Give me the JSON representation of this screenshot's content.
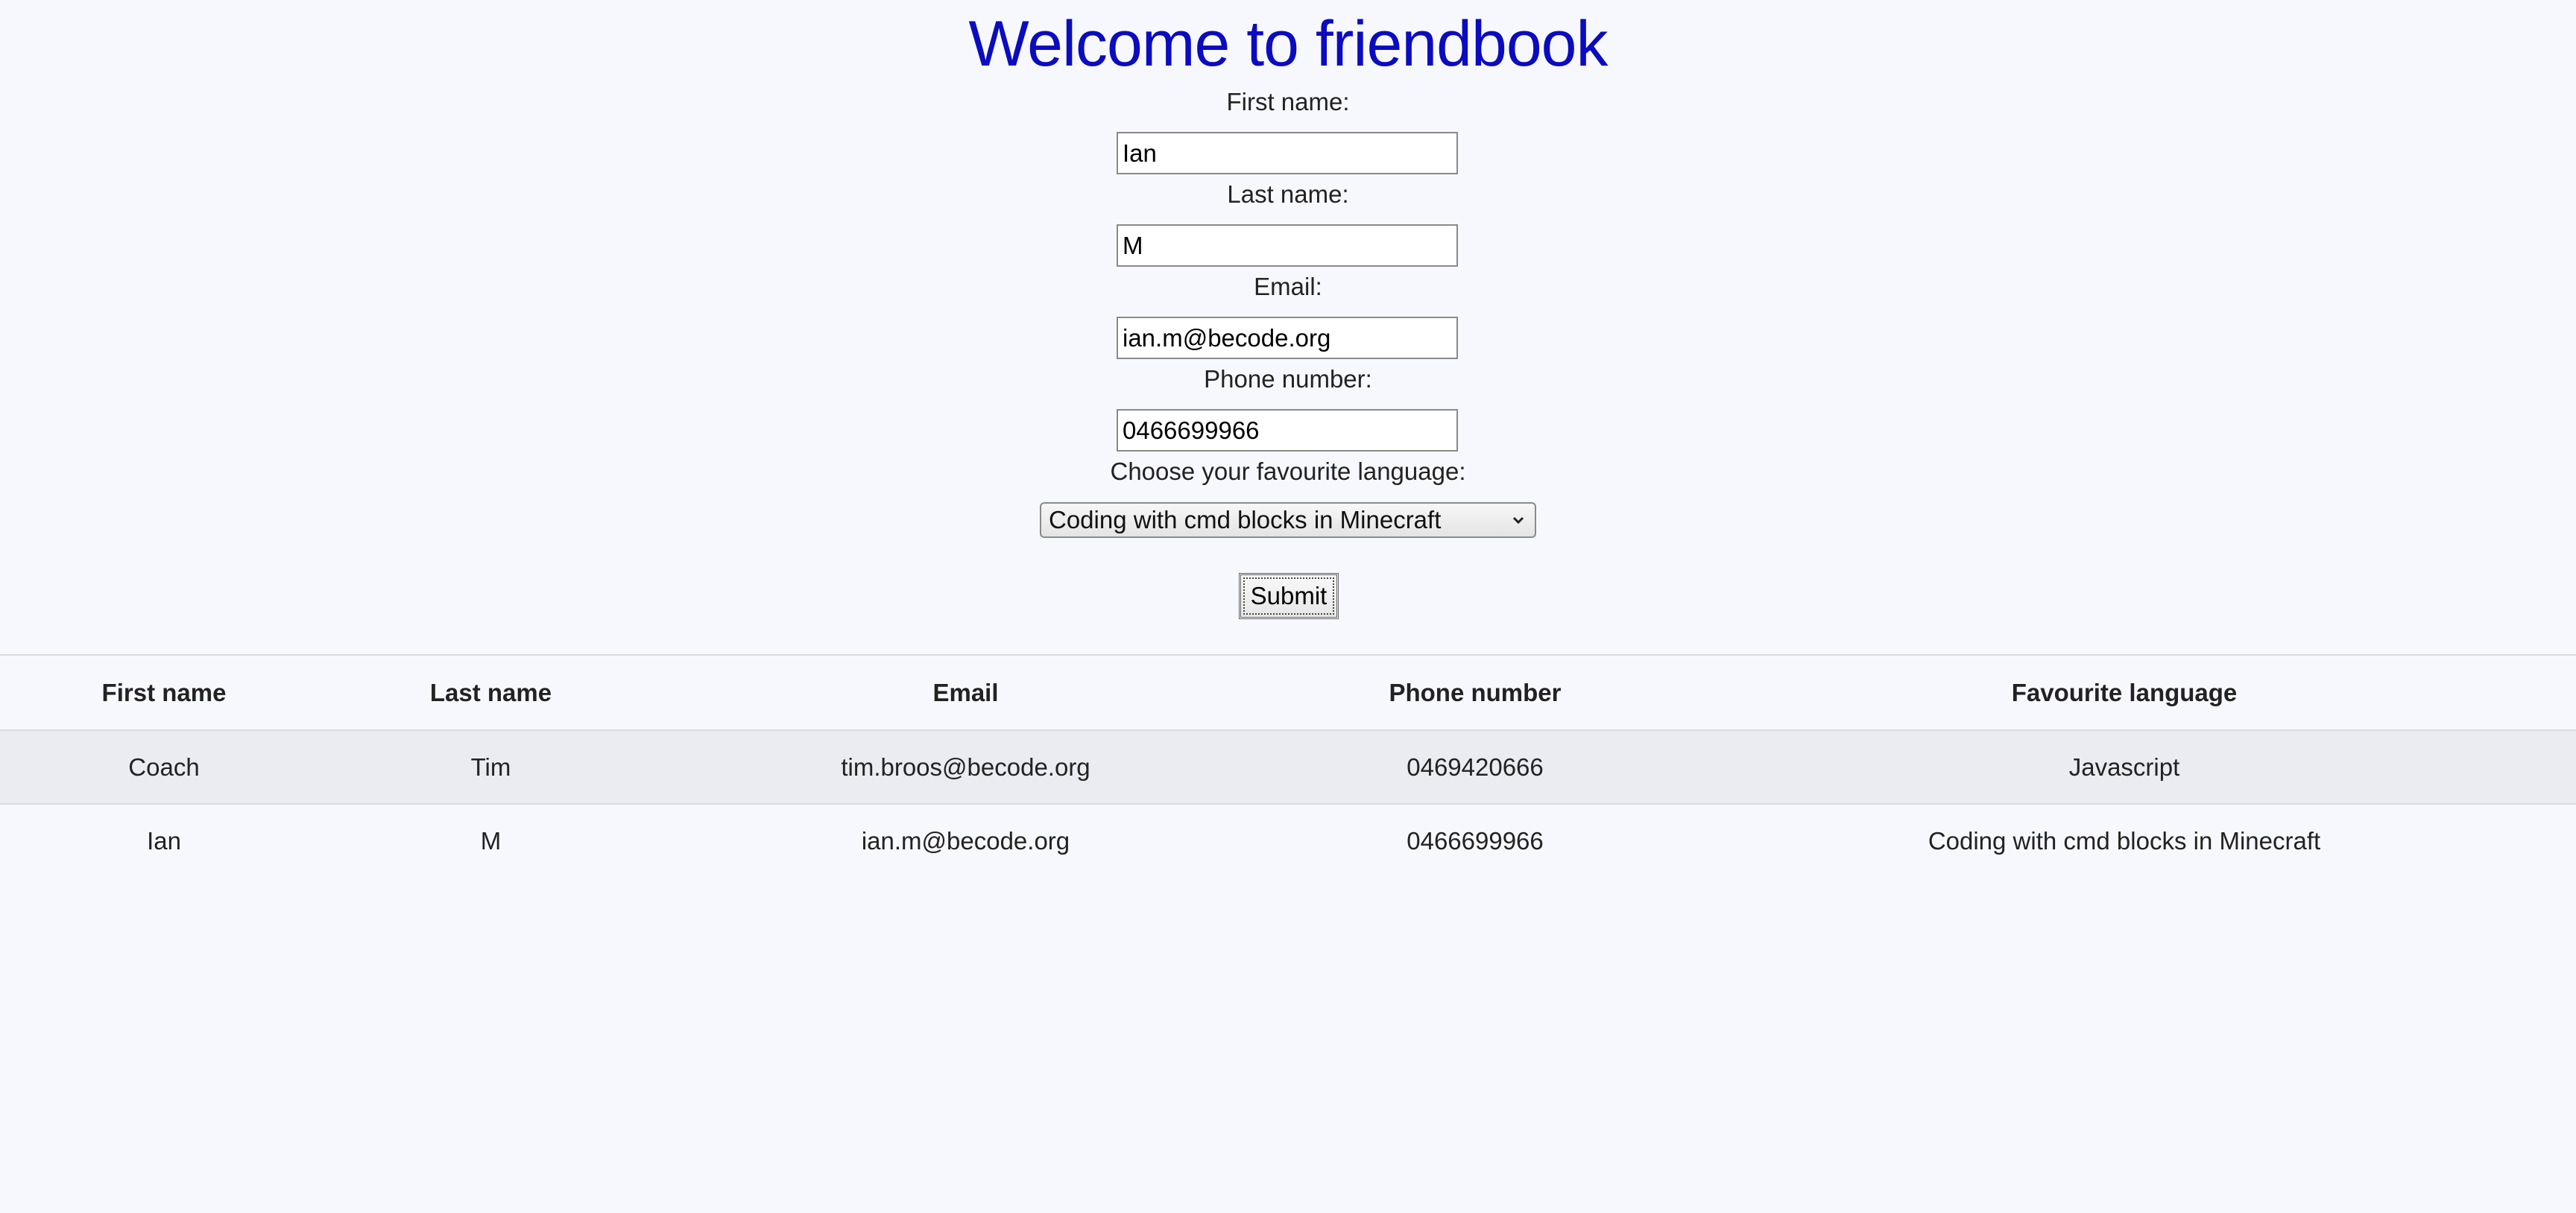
{
  "page": {
    "title": "Welcome to friendbook",
    "title_color": "#0b0bbf",
    "background": "#f7f8fd"
  },
  "form": {
    "first_name": {
      "label": "First name:",
      "value": "Ian"
    },
    "last_name": {
      "label": "Last name:",
      "value": "M"
    },
    "email": {
      "label": "Email:",
      "value": "ian.m@becode.org"
    },
    "phone": {
      "label": "Phone number:",
      "value": "0466699966"
    },
    "language": {
      "label": "Choose your favourite language:",
      "selected": "Coding with cmd blocks in Minecraft"
    },
    "submit_label": "Submit"
  },
  "table": {
    "headers": [
      "First name",
      "Last name",
      "Email",
      "Phone number",
      "Favourite language"
    ],
    "rows": [
      [
        "Coach",
        "Tim",
        "tim.broos@becode.org",
        "0469420666",
        "Javascript"
      ],
      [
        "Ian",
        "M",
        "ian.m@becode.org",
        "0466699966",
        "Coding with cmd blocks in Minecraft"
      ]
    ]
  }
}
